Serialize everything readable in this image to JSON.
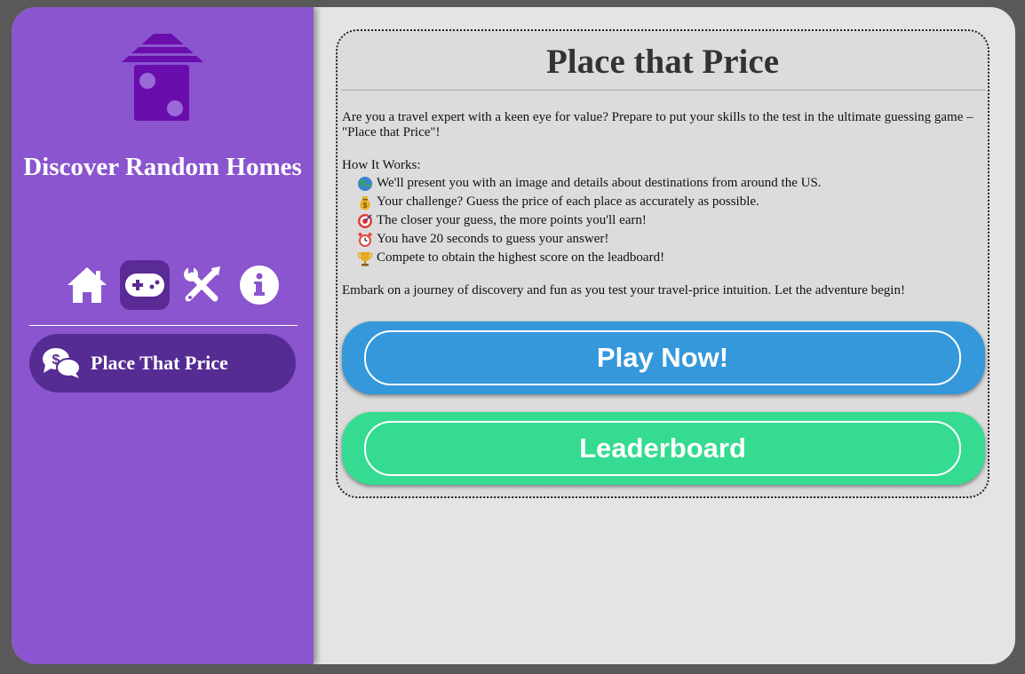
{
  "colors": {
    "sidebar_bg": "#8a55ce",
    "sidebar_active": "#552c93",
    "logo_purple": "#6a0dad",
    "play_button": "#3498db",
    "leaderboard_button": "#34db91",
    "content_bg": "#e4e4e4"
  },
  "sidebar": {
    "logo_icon": "house-dice-logo",
    "title": "Discover Random Homes",
    "nav": [
      {
        "icon": "house-icon",
        "active": false
      },
      {
        "icon": "gamepad-icon",
        "active": true
      },
      {
        "icon": "tools-icon",
        "active": false
      },
      {
        "icon": "info-icon",
        "active": false
      }
    ],
    "menu_item": {
      "icon": "price-chat-icon",
      "label": "Place That Price"
    }
  },
  "main": {
    "title": "Place that Price",
    "intro": "Are you a travel expert with a keen eye for value? Prepare to put your skills to the test in the ultimate guessing game – \"Place that Price\"!",
    "how_heading": "How It Works:",
    "steps": [
      {
        "icon": "globe-emoji",
        "text": "We'll present you with an image and details about destinations from around the US."
      },
      {
        "icon": "money-bag-emoji",
        "text": "Your challenge? Guess the price of each place as accurately as possible."
      },
      {
        "icon": "target-emoji",
        "text": "The closer your guess, the more points you'll earn!"
      },
      {
        "icon": "alarm-clock-emoji",
        "text": "You have 20 seconds to guess your answer!"
      },
      {
        "icon": "trophy-emoji",
        "text": "Compete to obtain the highest score on the leadboard!"
      }
    ],
    "closing": "Embark on a journey of discovery and fun as you test your travel-price intuition. Let the adventure begin!",
    "play_label": "Play Now!",
    "leaderboard_label": "Leaderboard"
  }
}
